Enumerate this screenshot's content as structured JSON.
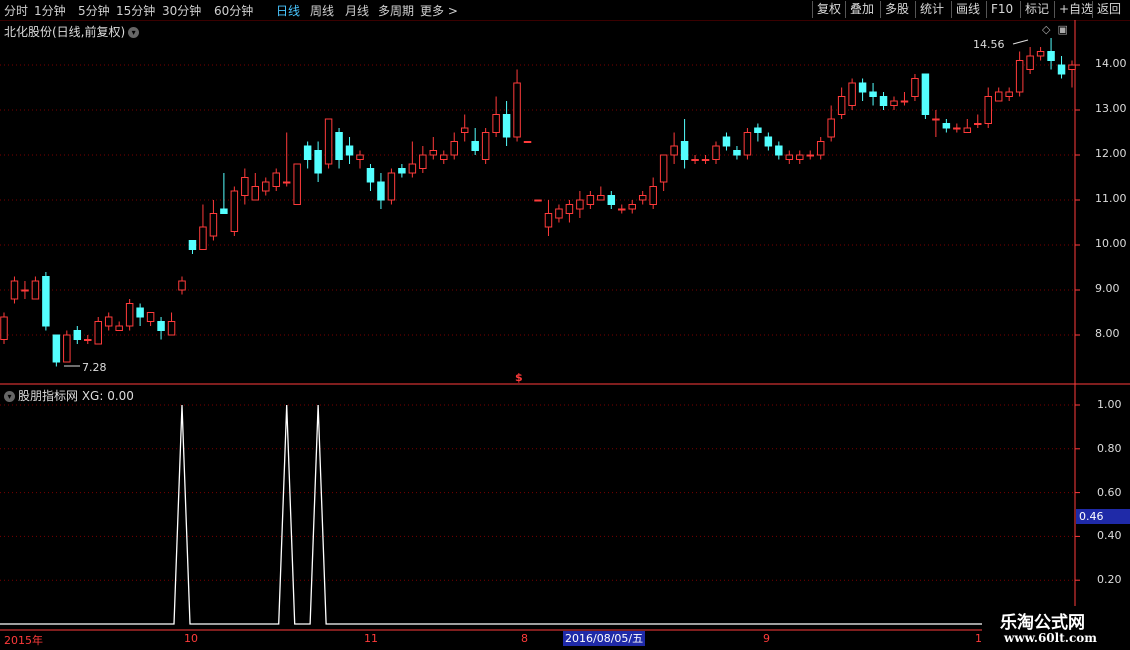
{
  "toolbar": {
    "tabs": [
      "分时",
      "1分钟",
      "5分钟",
      "15分钟",
      "30分钟",
      "60分钟",
      "日线",
      "周线",
      "月线",
      "多周期",
      "更多 >"
    ],
    "active_tab": "日线",
    "right_buttons": [
      "复权",
      "叠加",
      "多股",
      "统计",
      "画线",
      "F10",
      "标记",
      "+自选",
      "返回"
    ]
  },
  "main_chart": {
    "title": "北化股份(日线,前复权)",
    "max_label": "14.56",
    "min_label": "7.28",
    "marker": "$",
    "price_ticks": [
      "14.00",
      "13.00",
      "12.00",
      "11.00",
      "10.00",
      "9.00",
      "8.00"
    ]
  },
  "indicator": {
    "title": "股朋指标网 XG: 0.00",
    "ticks": [
      "1.00",
      "0.80",
      "0.60",
      "0.40",
      "0.20"
    ],
    "cursor_value": "0.46"
  },
  "date_axis": {
    "labels": [
      "2015年",
      "10",
      "11",
      "8",
      "9",
      "1"
    ],
    "cursor_date": "2016/08/05/五"
  },
  "watermark": {
    "line1": "乐淘公式网",
    "line2": "www.60lt.com"
  },
  "colors": {
    "up": "#ff3b3b",
    "down": "#54ffff",
    "grid": "#7a0000",
    "axis": "#ff3b3b",
    "background": "#000000"
  },
  "chart_data": {
    "type": "candlestick",
    "y_range": [
      7.0,
      15.0
    ],
    "candles": [
      [
        7.9,
        8.4,
        8.5,
        7.8
      ],
      [
        8.8,
        9.2,
        9.3,
        8.7
      ],
      [
        9.0,
        9.0,
        9.2,
        8.8
      ],
      [
        8.8,
        9.2,
        9.3,
        8.8
      ],
      [
        9.3,
        8.2,
        9.4,
        8.1
      ],
      [
        8.0,
        7.4,
        8.0,
        7.3
      ],
      [
        7.4,
        8.0,
        8.1,
        7.4
      ],
      [
        8.1,
        7.9,
        8.2,
        7.8
      ],
      [
        7.9,
        7.9,
        8.0,
        7.8
      ],
      [
        7.8,
        8.3,
        8.4,
        7.8
      ],
      [
        8.2,
        8.4,
        8.5,
        8.1
      ],
      [
        8.1,
        8.2,
        8.3,
        8.1
      ],
      [
        8.2,
        8.7,
        8.8,
        8.1
      ],
      [
        8.6,
        8.4,
        8.7,
        8.2
      ],
      [
        8.3,
        8.5,
        8.5,
        8.2
      ],
      [
        8.3,
        8.1,
        8.4,
        7.9
      ],
      [
        8.0,
        8.3,
        8.5,
        8.0
      ],
      [
        9.0,
        9.2,
        9.3,
        8.9
      ],
      [
        10.1,
        9.9,
        10.1,
        9.8
      ],
      [
        9.9,
        10.4,
        10.9,
        9.9
      ],
      [
        10.2,
        10.7,
        11.0,
        10.1
      ],
      [
        10.8,
        10.7,
        11.6,
        10.7
      ],
      [
        10.3,
        11.2,
        11.3,
        10.2
      ],
      [
        11.1,
        11.5,
        11.7,
        10.9
      ],
      [
        11.0,
        11.3,
        11.6,
        11.0
      ],
      [
        11.2,
        11.4,
        11.5,
        11.1
      ],
      [
        11.3,
        11.6,
        11.7,
        11.2
      ],
      [
        11.4,
        11.4,
        12.5,
        11.3
      ],
      [
        10.9,
        11.8,
        11.8,
        10.9
      ],
      [
        12.2,
        11.9,
        12.3,
        11.7
      ],
      [
        12.1,
        11.6,
        12.3,
        11.4
      ],
      [
        11.8,
        12.8,
        12.8,
        11.7
      ],
      [
        12.5,
        11.9,
        12.6,
        11.7
      ],
      [
        12.2,
        12.0,
        12.4,
        11.8
      ],
      [
        11.9,
        12.0,
        12.1,
        11.7
      ],
      [
        11.7,
        11.4,
        11.8,
        11.2
      ],
      [
        11.4,
        11.0,
        11.6,
        10.8
      ],
      [
        11.0,
        11.6,
        11.7,
        10.9
      ],
      [
        11.7,
        11.6,
        11.8,
        11.5
      ],
      [
        11.6,
        11.8,
        12.3,
        11.5
      ],
      [
        11.7,
        12.0,
        12.2,
        11.6
      ],
      [
        12.0,
        12.1,
        12.4,
        11.9
      ],
      [
        11.9,
        12.0,
        12.1,
        11.8
      ],
      [
        12.0,
        12.3,
        12.5,
        11.9
      ],
      [
        12.5,
        12.6,
        12.9,
        12.3
      ],
      [
        12.3,
        12.1,
        12.6,
        12.0
      ],
      [
        11.9,
        12.5,
        12.6,
        11.8
      ],
      [
        12.5,
        12.9,
        13.3,
        12.4
      ],
      [
        12.9,
        12.4,
        13.2,
        12.2
      ],
      [
        12.4,
        13.6,
        13.9,
        12.3
      ],
      [
        12.3,
        12.3,
        12.3,
        12.3
      ],
      [
        11.0,
        11.0,
        11.0,
        11.0
      ],
      [
        10.4,
        10.7,
        11.0,
        10.2
      ],
      [
        10.6,
        10.8,
        10.9,
        10.5
      ],
      [
        10.7,
        10.9,
        11.0,
        10.5
      ],
      [
        10.8,
        11.0,
        11.2,
        10.6
      ],
      [
        10.9,
        11.1,
        11.2,
        10.8
      ],
      [
        11.0,
        11.1,
        11.3,
        11.0
      ],
      [
        11.1,
        10.9,
        11.2,
        10.8
      ],
      [
        10.8,
        10.8,
        10.9,
        10.7
      ],
      [
        10.8,
        10.9,
        11.0,
        10.7
      ],
      [
        11.0,
        11.1,
        11.2,
        10.9
      ],
      [
        10.9,
        11.3,
        11.5,
        10.8
      ],
      [
        11.4,
        12.0,
        12.0,
        11.2
      ],
      [
        12.0,
        12.2,
        12.5,
        11.8
      ],
      [
        12.3,
        11.9,
        12.8,
        11.7
      ],
      [
        11.9,
        11.9,
        12.0,
        11.8
      ],
      [
        11.9,
        11.9,
        12.0,
        11.8
      ],
      [
        11.9,
        12.2,
        12.3,
        11.8
      ],
      [
        12.4,
        12.2,
        12.5,
        12.1
      ],
      [
        12.1,
        12.0,
        12.2,
        11.9
      ],
      [
        12.0,
        12.5,
        12.6,
        11.9
      ],
      [
        12.6,
        12.5,
        12.7,
        12.3
      ],
      [
        12.4,
        12.2,
        12.5,
        12.1
      ],
      [
        12.2,
        12.0,
        12.3,
        11.9
      ],
      [
        11.9,
        12.0,
        12.1,
        11.8
      ],
      [
        11.9,
        12.0,
        12.1,
        11.8
      ],
      [
        12.0,
        12.0,
        12.1,
        11.9
      ],
      [
        12.0,
        12.3,
        12.4,
        11.9
      ],
      [
        12.4,
        12.8,
        13.1,
        12.3
      ],
      [
        12.9,
        13.3,
        13.5,
        12.8
      ],
      [
        13.1,
        13.6,
        13.7,
        13.0
      ],
      [
        13.6,
        13.4,
        13.7,
        13.2
      ],
      [
        13.4,
        13.3,
        13.6,
        13.1
      ],
      [
        13.3,
        13.1,
        13.4,
        13.0
      ],
      [
        13.1,
        13.2,
        13.3,
        13.0
      ],
      [
        13.2,
        13.2,
        13.4,
        13.1
      ],
      [
        13.3,
        13.7,
        13.8,
        13.2
      ],
      [
        13.8,
        12.9,
        13.8,
        12.8
      ],
      [
        12.8,
        12.8,
        13.0,
        12.4
      ],
      [
        12.7,
        12.6,
        12.8,
        12.5
      ],
      [
        12.6,
        12.6,
        12.7,
        12.5
      ],
      [
        12.5,
        12.6,
        12.8,
        12.5
      ],
      [
        12.7,
        12.7,
        12.9,
        12.6
      ],
      [
        12.7,
        13.3,
        13.5,
        12.6
      ],
      [
        13.2,
        13.4,
        13.5,
        13.2
      ],
      [
        13.3,
        13.4,
        13.5,
        13.2
      ],
      [
        13.4,
        14.1,
        14.3,
        13.3
      ],
      [
        13.9,
        14.2,
        14.4,
        13.8
      ],
      [
        14.2,
        14.3,
        14.4,
        14.1
      ],
      [
        14.3,
        14.1,
        14.6,
        13.9
      ],
      [
        14.0,
        13.8,
        14.2,
        13.7
      ],
      [
        13.9,
        14.0,
        14.1,
        13.5
      ]
    ],
    "xg_signal_indices": [
      17,
      27,
      30
    ]
  }
}
